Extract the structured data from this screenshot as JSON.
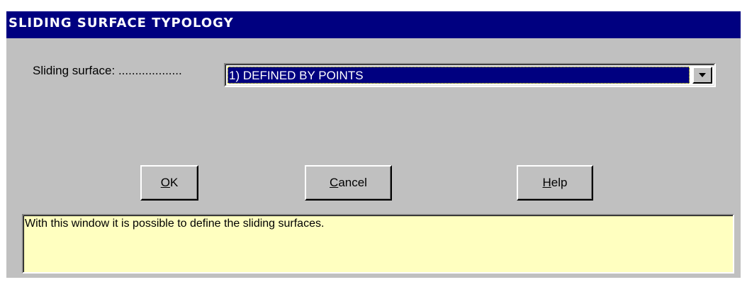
{
  "window": {
    "title": "SLIDING SURFACE TYPOLOGY"
  },
  "form": {
    "sliding_surface_label": "Sliding surface: ...................",
    "sliding_surface_value": "1) DEFINED BY POINTS"
  },
  "buttons": {
    "ok": {
      "mnemonic": "O",
      "rest": "K"
    },
    "cancel": {
      "mnemonic": "C",
      "rest": "ancel"
    },
    "help": {
      "mnemonic": "H",
      "rest": "elp"
    }
  },
  "info": {
    "text": "With this window it is possible to define the sliding surfaces."
  },
  "icons": {
    "dropdown": "chevron-down-icon"
  },
  "colors": {
    "titlebar_bg": "#000080",
    "face": "#c0c0c0",
    "selection": "#000080",
    "info_bg": "#ffffc0"
  }
}
